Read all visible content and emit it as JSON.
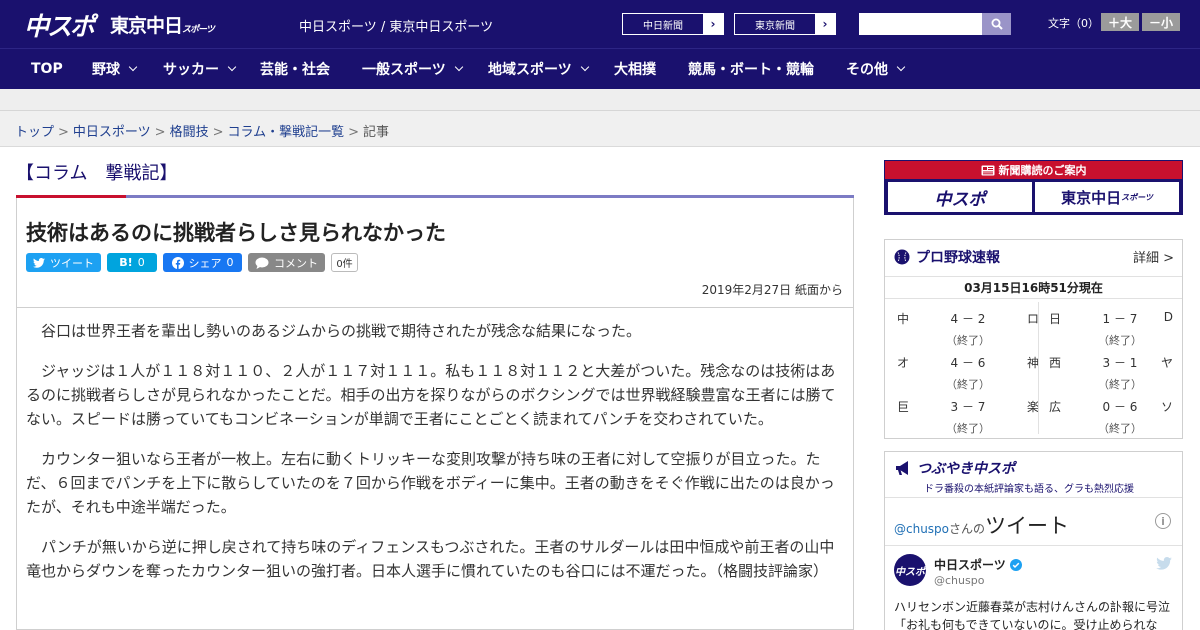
{
  "header": {
    "logo_chunichi_sports": "中スポ",
    "logo_tokyo_chunichi": "東京中日",
    "logo_tokyo_chunichi_suffix": "スポーツ",
    "site_name": "中日スポーツ / 東京中日スポーツ",
    "paper_buttons": [
      "中日新聞",
      "東京新聞"
    ],
    "font_size_label": "文字（0）",
    "font_bigger": "＋大",
    "font_smaller": "－小"
  },
  "nav": {
    "items": [
      {
        "label": "TOP",
        "dropdown": false
      },
      {
        "label": "野球",
        "dropdown": true
      },
      {
        "label": "サッカー",
        "dropdown": true
      },
      {
        "label": "芸能・社会",
        "dropdown": false
      },
      {
        "label": "一般スポーツ",
        "dropdown": true
      },
      {
        "label": "地域スポーツ",
        "dropdown": true
      },
      {
        "label": "大相撲",
        "dropdown": false
      },
      {
        "label": "競馬・ボート・競輪",
        "dropdown": false
      },
      {
        "label": "その他",
        "dropdown": true
      }
    ]
  },
  "breadcrumb": {
    "items": [
      "トップ",
      "中日スポーツ",
      "格闘技",
      "コラム・撃戦記一覧"
    ],
    "current": "記事"
  },
  "article": {
    "column_title": "【コラム　撃戦記】",
    "headline": "技術はあるのに挑戦者らしさ見られなかった",
    "share": {
      "tweet": "ツイート",
      "hatena": "B!",
      "hatena_count": "0",
      "facebook": "シェア",
      "facebook_count": "0",
      "comment": "コメント",
      "comment_count": "0件"
    },
    "dateline": "2019年2月27日 紙面から",
    "paragraphs": [
      "谷口は世界王者を輩出し勢いのあるジムからの挑戦で期待されたが残念な結果になった。",
      "ジャッジは１人が１１８対１１０、２人が１１７対１１１。私も１１８対１１２と大差がついた。残念なのは技術はあるのに挑戦者らしさが見られなかったことだ。相手の出方を探りながらのボクシングでは世界戦経験豊富な王者には勝てない。スピードは勝っていてもコンビネーションが単調で王者にことごとく読まれてパンチを交わされていた。",
      "カウンター狙いなら王者が一枚上。左右に動くトリッキーな変則攻撃が持ち味の王者に対して空振りが目立った。ただ、６回までパンチを上下に散らしていたのを７回から作戦をボディーに集中。王者の動きをそぐ作戦に出たのは良かったが、それも中途半端だった。",
      "パンチが無いから逆に押し戻されて持ち味のディフェンスもつぶされた。王者のサルダールは田中恒成や前王者の山中竜也からダウンを奪ったカウンター狙いの強打者。日本人選手に慣れていたのも谷口には不運だった。（格闘技評論家）"
    ]
  },
  "sidebar": {
    "subscribe": {
      "header": "新聞購読のご案内",
      "logo_left": "中スポ",
      "logo_right": "東京中日",
      "logo_right_suffix": "スポーツ"
    },
    "baseball": {
      "title": "プロ野球速報",
      "more": "詳細 >",
      "timestamp": "03月15日16時51分現在",
      "games": [
        {
          "home": "中",
          "score": "4 － 2",
          "away": "ロ",
          "status": "（終了）"
        },
        {
          "home": "日",
          "score": "1 － 7",
          "away": "D",
          "status": "（終了）"
        },
        {
          "home": "オ",
          "score": "4 － 6",
          "away": "神",
          "status": "（終了）"
        },
        {
          "home": "西",
          "score": "3 － 1",
          "away": "ヤ",
          "status": "（終了）"
        },
        {
          "home": "巨",
          "score": "3 － 7",
          "away": "楽",
          "status": "（終了）"
        },
        {
          "home": "広",
          "score": "0 － 6",
          "away": "ソ",
          "status": "（終了）"
        }
      ]
    },
    "tsubuyaki": {
      "title": "つぶやき中スポ",
      "subtitle": "ドラ番殺の本紙評論家も語る、グラも熱烈応援",
      "handle": "@chuspo",
      "handle_suffix": "さんの",
      "tweet_label": "ツイート",
      "account_name": "中日スポーツ",
      "account_handle": "@chuspo",
      "avatar_text": "中スポ",
      "tweet_text": "ハリセンボン近藤春菜が志村けんさんの訃報に号泣「お礼も何もできていないのに。受け止められな"
    }
  },
  "colors": {
    "brand_navy": "#1a116e",
    "accent_red": "#c8102e",
    "twitter_blue": "#1da1f2",
    "hatena_blue": "#00a4de",
    "facebook_blue": "#1877f2"
  }
}
